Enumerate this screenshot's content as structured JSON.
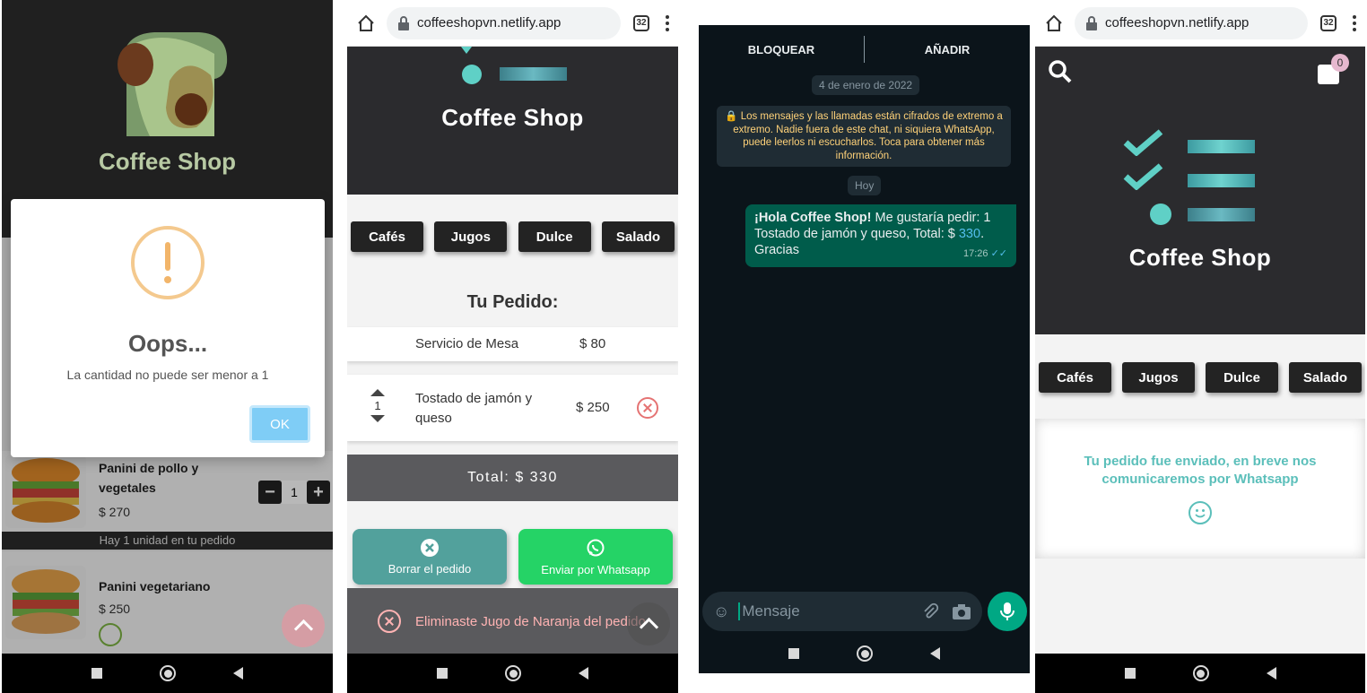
{
  "brand": "Coffee Shop",
  "categories": [
    "Cafés",
    "Jugos",
    "Dulce",
    "Salado"
  ],
  "browser": {
    "url": "coffeeshopvn.netlify.app",
    "tabs": "32"
  },
  "panel1": {
    "alert": {
      "title": "Oops...",
      "message": "La cantidad no puede ser menor a 1",
      "ok_label": "OK"
    },
    "products": [
      {
        "name_line1": "Panini de pollo y",
        "name_line2": "vegetales",
        "price": "$ 270",
        "qty": "1",
        "note": "Hay 1 unidad en tu pedido"
      },
      {
        "name": "Panini vegetariano",
        "price": "$ 250"
      }
    ]
  },
  "panel2": {
    "order_title": "Tu Pedido:",
    "service": {
      "label": "Servicio de Mesa",
      "price": "$ 80"
    },
    "item": {
      "qty": "1",
      "name_line1": "Tostado de jamón y",
      "name_line2": "queso",
      "price": "$ 250"
    },
    "total": "Total: $ 330",
    "delete_label": "Borrar el pedido",
    "send_label": "Enviar por Whatsapp",
    "toast": "Eliminaste Jugo de Naranja del pedido",
    "colors": {
      "delete": "#52a19c",
      "send": "#25d366"
    }
  },
  "panel3": {
    "block_label": "BLOQUEAR",
    "add_label": "AÑADIR",
    "date_chip": "4 de enero de 2022",
    "encryption_notice": "Los mensajes y las llamadas están cifrados de extremo a extremo. Nadie fuera de este chat, ni siquiera WhatsApp, puede leerlos ni escucharlos. Toca para obtener más información.",
    "today_chip": "Hoy",
    "message_bold": "¡Hola Coffee Shop!",
    "message_rest": " Me gustaría pedir: 1 Tostado de jamón y queso,  Total: $ ",
    "message_amount": "330",
    "message_end": ". Gracias",
    "message_time": "17:26",
    "input_placeholder": "Mensaje"
  },
  "panel4": {
    "cart_count": "0",
    "sent_message": "Tu pedido fue enviado, en breve nos comunicaremos por Whatsapp"
  }
}
